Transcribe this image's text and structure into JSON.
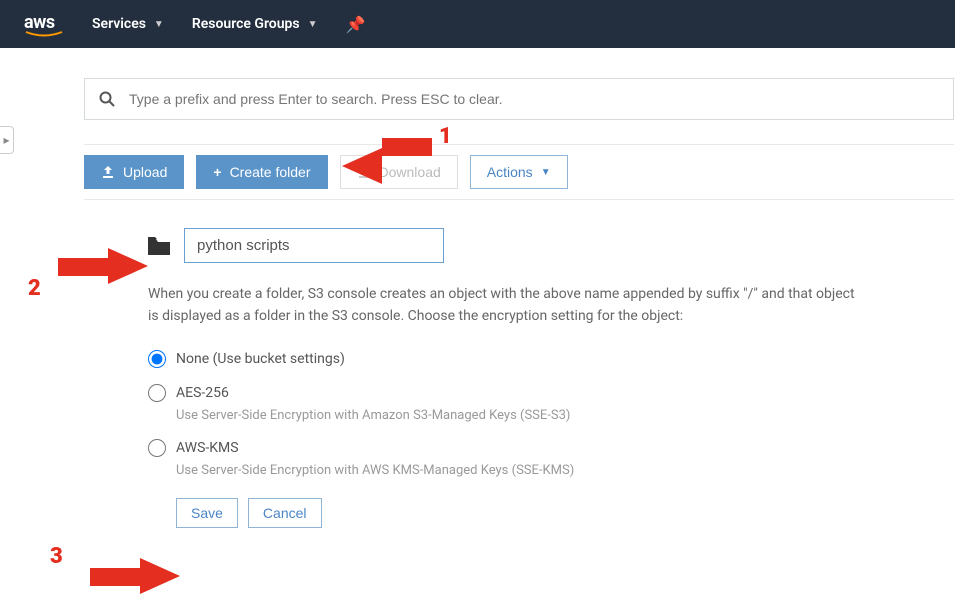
{
  "nav": {
    "services_label": "Services",
    "resource_groups_label": "Resource Groups"
  },
  "search": {
    "placeholder": "Type a prefix and press Enter to search. Press ESC to clear."
  },
  "toolbar": {
    "upload_label": "Upload",
    "create_folder_label": "Create folder",
    "download_label": "Download",
    "actions_label": "Actions"
  },
  "folder_form": {
    "name_value": "python scripts",
    "name_placeholder": "",
    "help": "When you create a folder, S3 console creates an object with the above name appended by suffix \"/\" and that object is displayed as a folder in the S3 console. Choose the encryption setting for the object:",
    "options": {
      "none": {
        "label": "None (Use bucket settings)"
      },
      "aes": {
        "label": "AES-256",
        "sub": "Use Server-Side Encryption with Amazon S3-Managed Keys (SSE-S3)"
      },
      "kms": {
        "label": "AWS-KMS",
        "sub": "Use Server-Side Encryption with AWS KMS-Managed Keys (SSE-KMS)"
      }
    },
    "save_label": "Save",
    "cancel_label": "Cancel"
  },
  "annotations": {
    "one": "1",
    "two": "2",
    "three": "3"
  }
}
